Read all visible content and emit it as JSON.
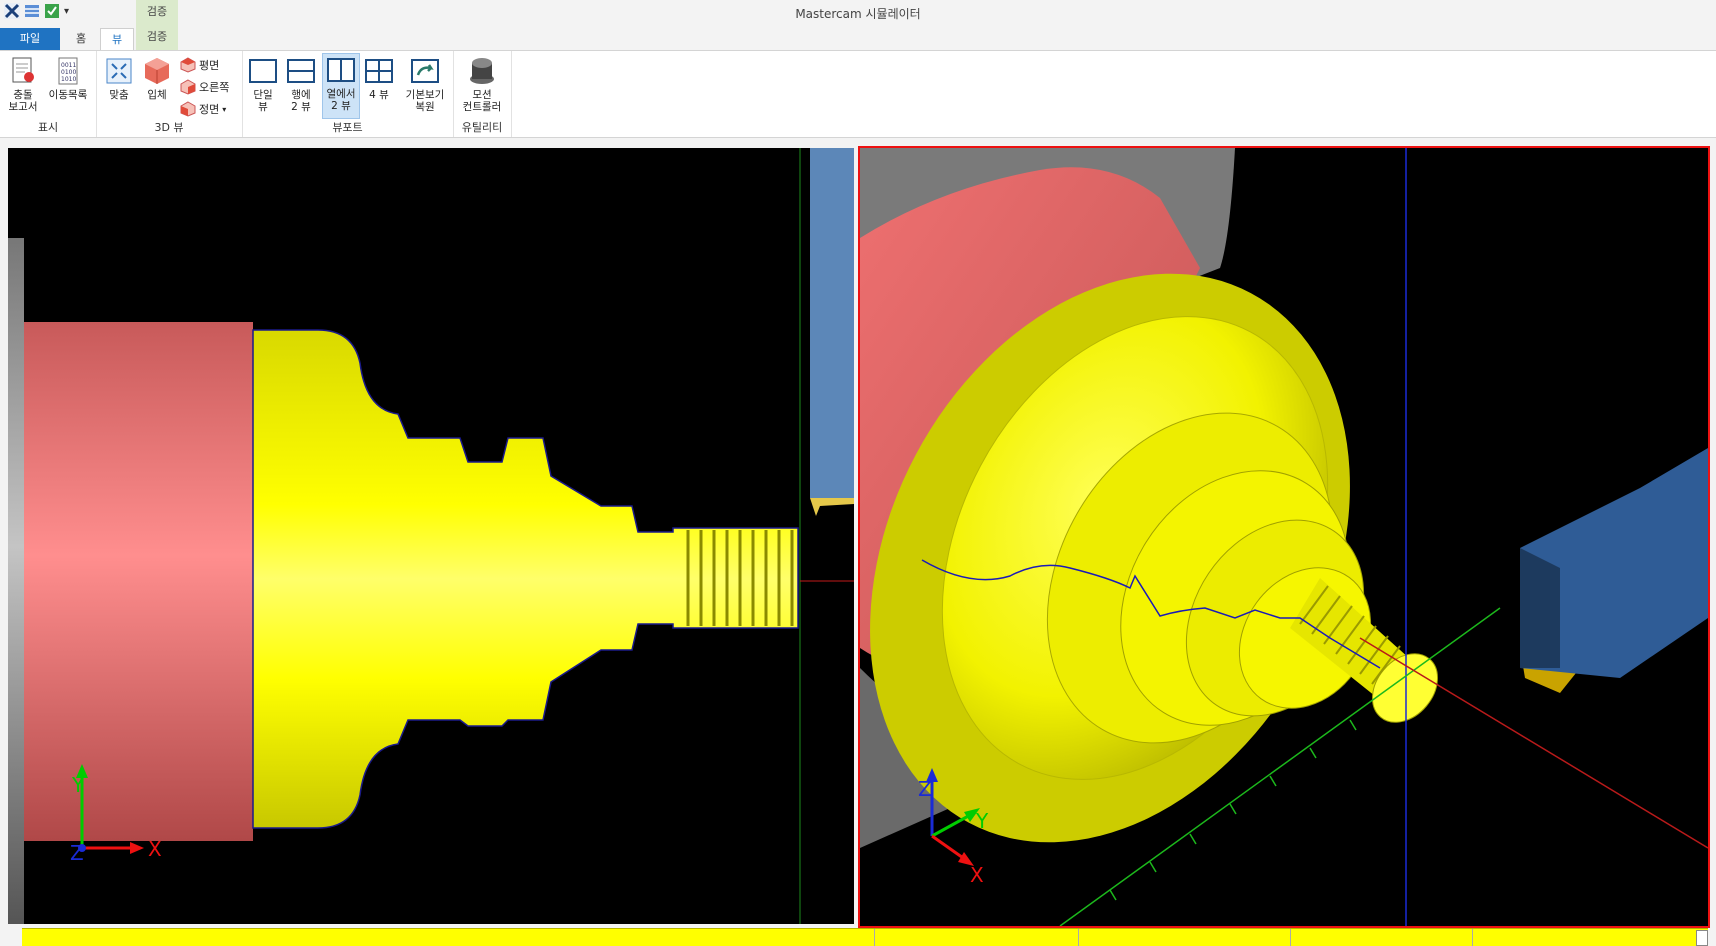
{
  "window": {
    "title": "Mastercam 시뮬레이터",
    "context_tab_title": "검증"
  },
  "tabs": [
    {
      "label": "파일"
    },
    {
      "label": "홈"
    },
    {
      "label": "뷰"
    },
    {
      "label": "검증"
    }
  ],
  "ribbon": {
    "groups": {
      "display": {
        "label": "표시",
        "buttons": [
          {
            "label1": "충돌",
            "label2": "보고서"
          },
          {
            "label1": "이동목록",
            "label2": ""
          }
        ]
      },
      "view3d": {
        "label": "3D 뷰",
        "buttons": [
          {
            "label1": "맞춤"
          },
          {
            "label1": "입체"
          }
        ],
        "small": [
          {
            "label": "평면"
          },
          {
            "label": "오른쪽"
          },
          {
            "label": "정면"
          }
        ]
      },
      "viewport": {
        "label": "뷰포트",
        "buttons": [
          {
            "label1": "단일",
            "label2": "뷰"
          },
          {
            "label1": "행에",
            "label2": "2 뷰"
          },
          {
            "label1": "열에서",
            "label2": "2 뷰"
          },
          {
            "label1": "4 뷰",
            "label2": ""
          },
          {
            "label1": "기본보기",
            "label2": "복원"
          }
        ]
      },
      "utility": {
        "label": "유틸리티",
        "buttons": [
          {
            "label1": "모션",
            "label2": "컨트롤러"
          }
        ]
      }
    }
  },
  "axes": {
    "left": {
      "y": "Y",
      "z": "Z",
      "x": "X"
    },
    "right": {
      "z": "Z",
      "y": "Y",
      "x": "X"
    }
  },
  "colors": {
    "accent": "#1f73c2",
    "part": "#ffff00",
    "stock": "#ee6b6b",
    "tool": "#4a6fa8",
    "active_border": "#e11111"
  }
}
